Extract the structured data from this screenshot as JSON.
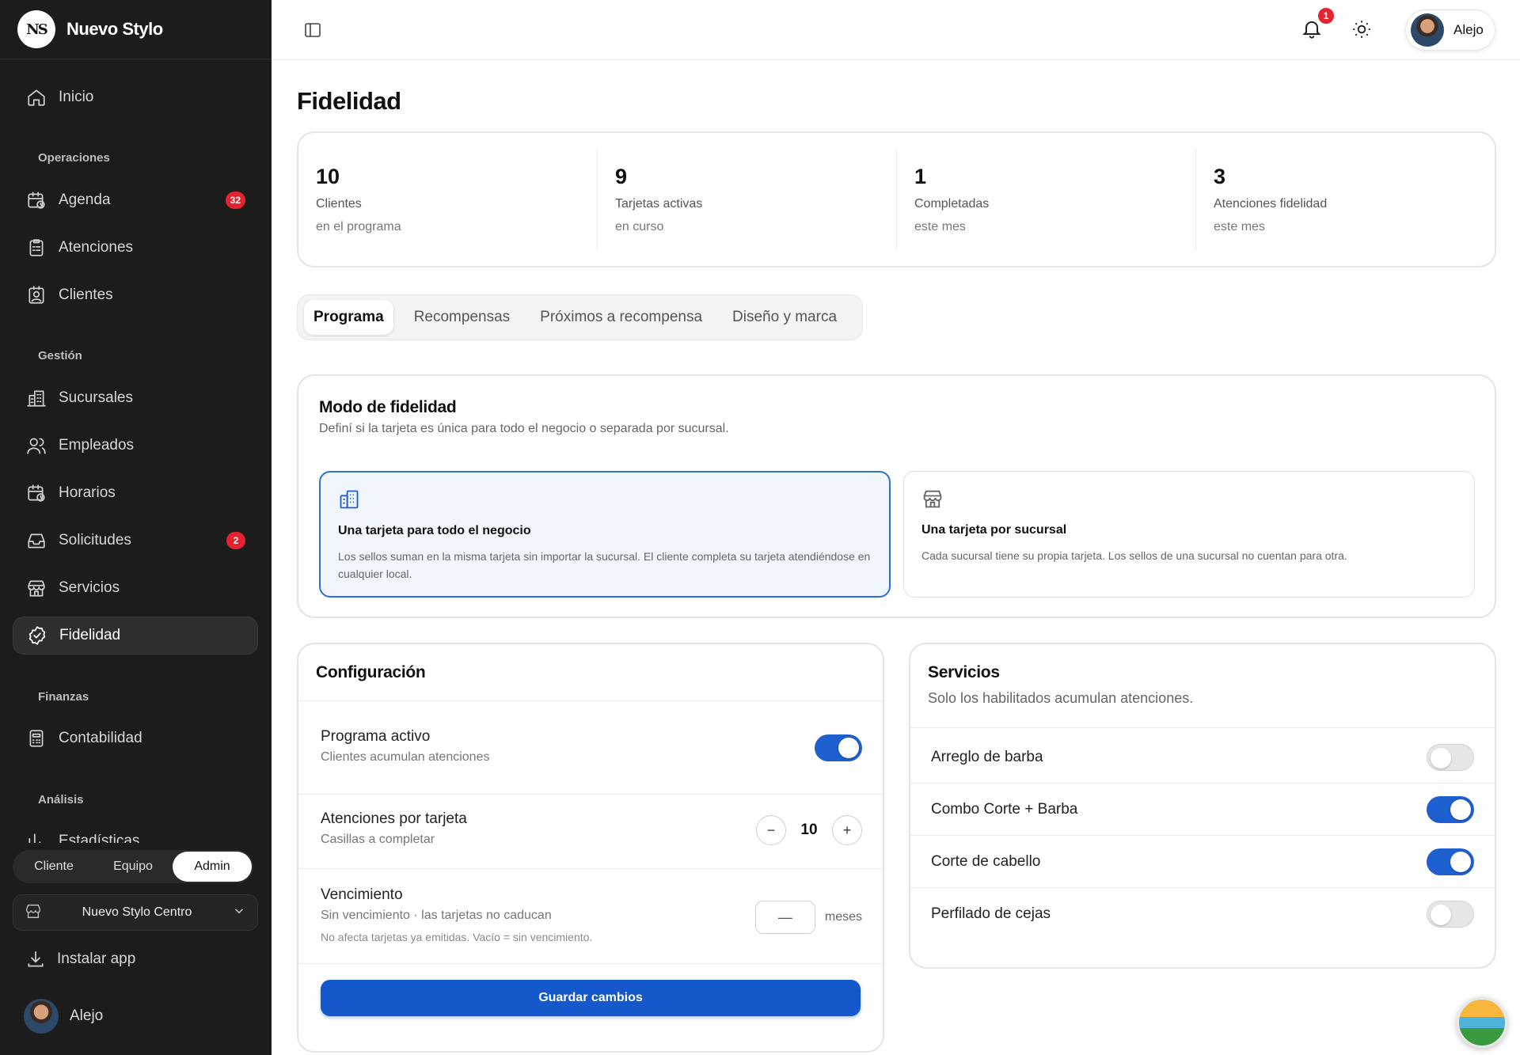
{
  "brand": {
    "logo_text": "NS",
    "name": "Nuevo Stylo"
  },
  "nav": {
    "home": {
      "label": "Inicio",
      "icon": "home-icon"
    },
    "sections": {
      "operaciones": "Operaciones",
      "gestion": "Gestión",
      "finanzas": "Finanzas",
      "analisis": "Análisis"
    },
    "items": [
      {
        "label": "Agenda",
        "icon": "calendar-clock-icon",
        "badge": "32"
      },
      {
        "label": "Atenciones",
        "icon": "clipboard-icon",
        "badge": ""
      },
      {
        "label": "Clientes",
        "icon": "contact-icon",
        "badge": ""
      },
      {
        "label": "Sucursales",
        "icon": "building-icon",
        "badge": ""
      },
      {
        "label": "Empleados",
        "icon": "users-icon",
        "badge": ""
      },
      {
        "label": "Horarios",
        "icon": "calendar-clock-icon",
        "badge": ""
      },
      {
        "label": "Solicitudes",
        "icon": "inbox-icon",
        "badge": "2"
      },
      {
        "label": "Servicios",
        "icon": "store-icon",
        "badge": ""
      },
      {
        "label": "Fidelidad",
        "icon": "badge-check-icon",
        "badge": "",
        "active": true
      },
      {
        "label": "Contabilidad",
        "icon": "calculator-icon",
        "badge": ""
      },
      {
        "label": "Estadísticas",
        "icon": "bar-chart-icon",
        "badge": ""
      }
    ]
  },
  "role_switch": {
    "options": [
      "Cliente",
      "Equipo",
      "Admin"
    ],
    "selected": "Admin"
  },
  "branch_select": {
    "value": "Nuevo Stylo Centro"
  },
  "install_label": "Instalar app",
  "user": {
    "name": "Alejo"
  },
  "topbar": {
    "notifications_count": "1"
  },
  "page": {
    "title": "Fidelidad"
  },
  "stats": [
    {
      "value": "10",
      "label": "Clientes",
      "sub": "en el programa"
    },
    {
      "value": "9",
      "label": "Tarjetas activas",
      "sub": "en curso"
    },
    {
      "value": "1",
      "label": "Completadas",
      "sub": "este mes"
    },
    {
      "value": "3",
      "label": "Atenciones fidelidad",
      "sub": "este mes"
    }
  ],
  "tabs": [
    "Programa",
    "Recompensas",
    "Próximos a recompensa",
    "Diseño y marca"
  ],
  "tabs_selected": "Programa",
  "mode": {
    "title": "Modo de fidelidad",
    "subtitle": "Definí si la tarjeta es única para todo el negocio o separada por sucursal.",
    "options": [
      {
        "title": "Una tarjeta para todo el negocio",
        "desc": "Los sellos suman en la misma tarjeta sin importar la sucursal. El cliente completa su tarjeta atendiéndose en cualquier local.",
        "selected": true,
        "icon": "building-icon"
      },
      {
        "title": "Una tarjeta por sucursal",
        "desc": "Cada sucursal tiene su propia tarjeta. Los sellos de una sucursal no cuentan para otra.",
        "selected": false,
        "icon": "store-icon"
      }
    ]
  },
  "config": {
    "title": "Configuración",
    "active": {
      "title": "Programa activo",
      "sub": "Clientes acumulan atenciones",
      "on": true
    },
    "per_card": {
      "title": "Atenciones por tarjeta",
      "sub": "Casillas a completar",
      "value": "10",
      "minus": "−",
      "plus": "+"
    },
    "expiry": {
      "title": "Vencimiento",
      "sub": "Sin vencimiento · las tarjetas no caducan",
      "note": "No afecta tarjetas ya emitidas. Vacío = sin vencimiento.",
      "placeholder": "—",
      "unit": "meses"
    },
    "save_label": "Guardar cambios"
  },
  "services": {
    "title": "Servicios",
    "subtitle": "Solo los habilitados acumulan atenciones.",
    "items": [
      {
        "name": "Arreglo de barba",
        "enabled": false
      },
      {
        "name": "Combo Corte + Barba",
        "enabled": true
      },
      {
        "name": "Corte de cabello",
        "enabled": true
      },
      {
        "name": "Perfilado de cejas",
        "enabled": false
      }
    ]
  },
  "colors": {
    "accent": "#1e5fd0",
    "sidebar_bg": "#1c1c1c",
    "badge": "#e5232e"
  }
}
